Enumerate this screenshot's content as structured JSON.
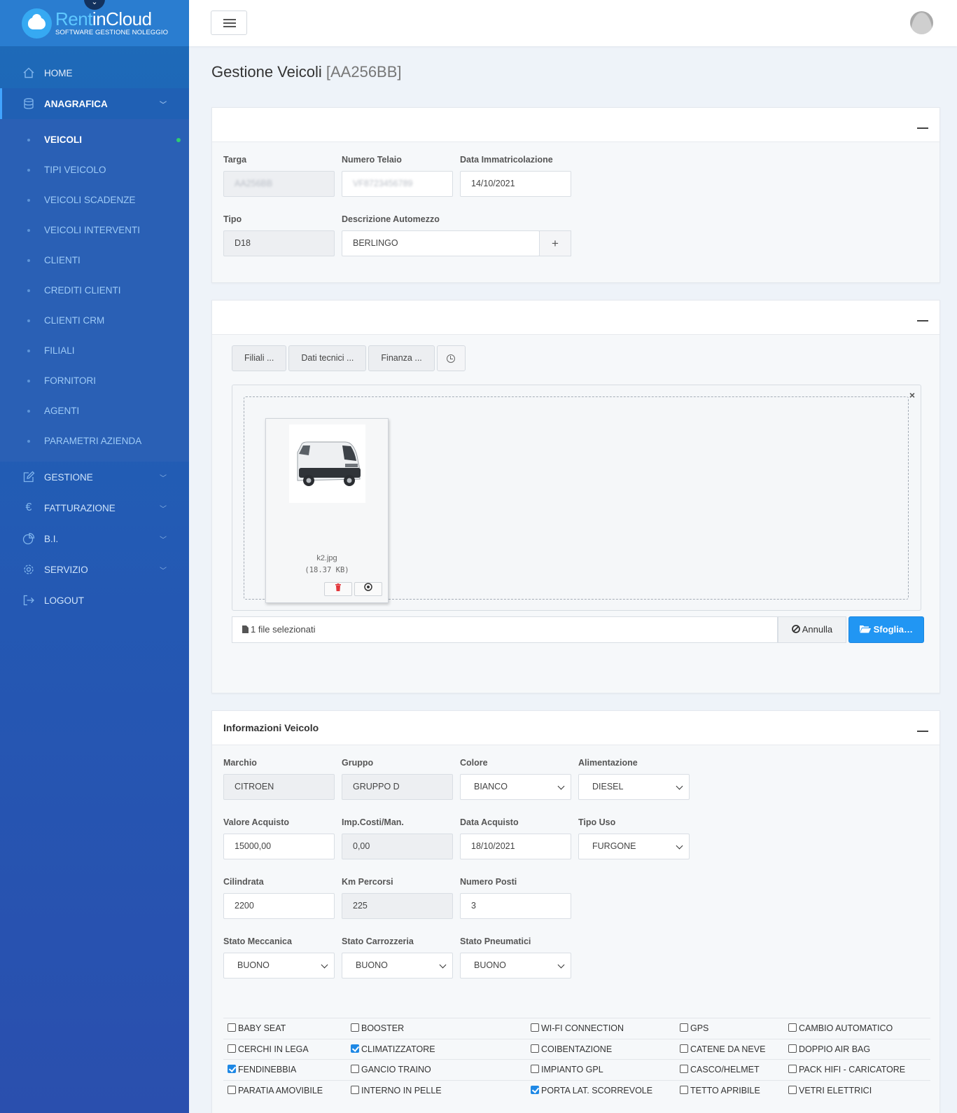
{
  "brand": {
    "name_part1": "Rent",
    "name_part2": "inCloud",
    "tagline": "SOFTWARE GESTIONE NOLEGGIO"
  },
  "sidebar": {
    "home": "HOME",
    "anagrafica": "ANAGRAFICA",
    "subitems": [
      "VEICOLI",
      "TIPI VEICOLO",
      "VEICOLI SCADENZE",
      "VEICOLI INTERVENTI",
      "CLIENTI",
      "CREDITI CLIENTI",
      "CLIENTI CRM",
      "FILIALI",
      "FORNITORI",
      "AGENTI",
      "PARAMETRI AZIENDA"
    ],
    "gestione": "GESTIONE",
    "fatturazione": "FATTURAZIONE",
    "bi": "B.I.",
    "servizio": "SERVIZIO",
    "logout": "LOGOUT"
  },
  "page": {
    "title": "Gestione Veicoli",
    "plate": "[AA256BB]"
  },
  "vehicle": {
    "targa_label": "Targa",
    "targa_value": "AA256BB",
    "telaio_label": "Numero Telaio",
    "telaio_value": "VF8723456789",
    "data_imm_label": "Data Immatricolazione",
    "data_imm_value": "14/10/2021",
    "tipo_label": "Tipo",
    "tipo_value": "D18",
    "descr_label": "Descrizione Automezzo",
    "descr_value": "BERLINGO",
    "descr_add": "+"
  },
  "media": {
    "tabs": [
      "Filiali ...",
      "Dati tecnici ...",
      "Finanza ..."
    ],
    "zone_close": "×",
    "file_name": "k2.jpg",
    "file_size": "(18.37 KB)",
    "selected_caption": "1 file selezionati",
    "cancel_label": "Annulla",
    "browse_label": "Sfoglia…"
  },
  "info": {
    "title": "Informazioni Veicolo",
    "marchio_label": "Marchio",
    "marchio_value": "CITROEN",
    "gruppo_label": "Gruppo",
    "gruppo_value": "GRUPPO D",
    "colore_label": "Colore",
    "colore_value": "BIANCO",
    "alim_label": "Alimentazione",
    "alim_value": "DIESEL",
    "valore_label": "Valore Acquisto",
    "valore_value": "15000,00",
    "imp_label": "Imp.Costi/Man.",
    "imp_value": "0,00",
    "data_acq_label": "Data Acquisto",
    "data_acq_value": "18/10/2021",
    "tipo_uso_label": "Tipo Uso",
    "tipo_uso_value": "FURGONE",
    "cilindrata_label": "Cilindrata",
    "cilindrata_value": "2200",
    "km_label": "Km Percorsi",
    "km_value": "225",
    "posti_label": "Numero Posti",
    "posti_value": "3",
    "mecc_label": "Stato Meccanica",
    "mecc_value": "BUONO",
    "carr_label": "Stato Carrozzeria",
    "carr_value": "BUONO",
    "pneu_label": "Stato Pneumatici",
    "pneu_value": "BUONO"
  },
  "options": [
    [
      {
        "label": "BABY SEAT",
        "checked": false
      },
      {
        "label": "BOOSTER",
        "checked": false
      },
      {
        "label": "WI-FI CONNECTION",
        "checked": false
      },
      {
        "label": "GPS",
        "checked": false
      },
      {
        "label": "CAMBIO AUTOMATICO",
        "checked": false
      }
    ],
    [
      {
        "label": "CERCHI IN LEGA",
        "checked": false
      },
      {
        "label": "CLIMATIZZATORE",
        "checked": true
      },
      {
        "label": "COIBENTAZIONE",
        "checked": false
      },
      {
        "label": "CATENE DA NEVE",
        "checked": false
      },
      {
        "label": "DOPPIO AIR BAG",
        "checked": false
      }
    ],
    [
      {
        "label": "FENDINEBBIA",
        "checked": true
      },
      {
        "label": "GANCIO TRAINO",
        "checked": false
      },
      {
        "label": "IMPIANTO GPL",
        "checked": false
      },
      {
        "label": "CASCO/HELMET",
        "checked": false
      },
      {
        "label": "PACK HIFI - CARICATORE",
        "checked": false
      }
    ],
    [
      {
        "label": "PARATIA AMOVIBILE",
        "checked": false
      },
      {
        "label": "INTERNO IN PELLE",
        "checked": false
      },
      {
        "label": "PORTA LAT. SCORREVOLE",
        "checked": true
      },
      {
        "label": "TETTO APRIBILE",
        "checked": false
      },
      {
        "label": "VETRI ELETTRICI",
        "checked": false
      }
    ]
  ],
  "colors": {
    "accent": "#2196f3",
    "sidebar": "#2458b3",
    "active_dot": "#2ecc71",
    "danger": "#e2363b"
  }
}
